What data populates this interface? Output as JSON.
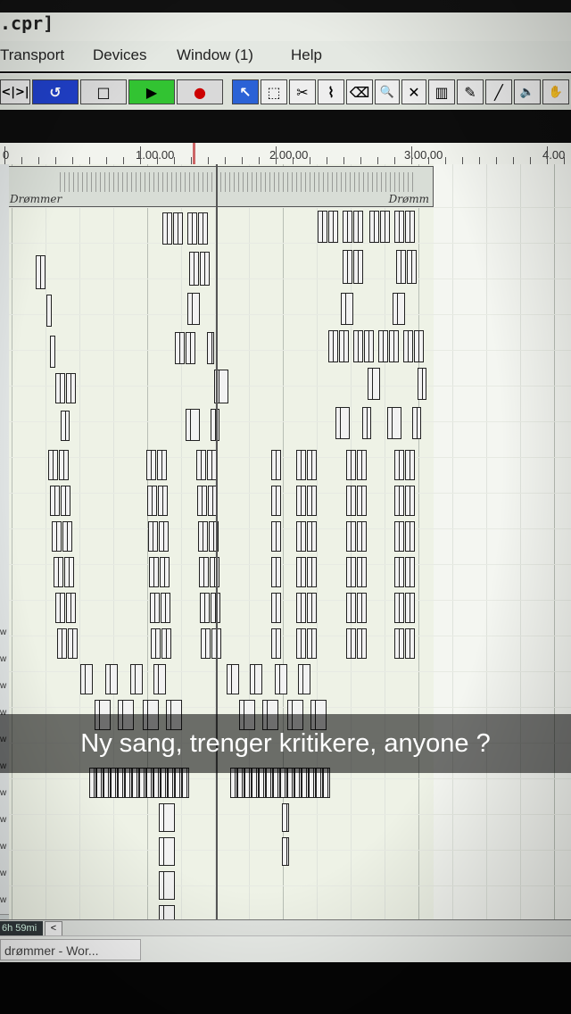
{
  "window": {
    "title": ".cpr]"
  },
  "menu": {
    "items": [
      "Transport",
      "Devices",
      "Window (1)",
      "Help"
    ]
  },
  "toolbar": {
    "transport_buttons": [
      {
        "icon": "skip-icon",
        "label": "<|>|"
      },
      {
        "icon": "cycle-icon",
        "label": "↺"
      },
      {
        "icon": "stop-icon",
        "label": "□"
      },
      {
        "icon": "play-icon",
        "label": "▶"
      },
      {
        "icon": "record-icon",
        "label": "●"
      }
    ],
    "tools": [
      {
        "icon": "pointer-icon",
        "glyph": "↖"
      },
      {
        "icon": "range-select-icon",
        "glyph": "⬚"
      },
      {
        "icon": "split-icon",
        "glyph": "✂"
      },
      {
        "icon": "glue-icon",
        "glyph": "⌇"
      },
      {
        "icon": "erase-icon",
        "glyph": "⌫"
      },
      {
        "icon": "zoom-icon",
        "glyph": "🔍"
      },
      {
        "icon": "mute-icon",
        "glyph": "✕"
      },
      {
        "icon": "comp-icon",
        "glyph": "▥"
      },
      {
        "icon": "draw-icon",
        "glyph": "✎"
      },
      {
        "icon": "line-icon",
        "glyph": "╱"
      },
      {
        "icon": "speaker-icon",
        "glyph": "🔈"
      },
      {
        "icon": "hand-icon",
        "glyph": "✋"
      }
    ],
    "colors": {
      "cycle": "#1f3fc7",
      "play": "#32c332",
      "record": "#cc0000",
      "pointer": "#2a62d6"
    }
  },
  "ruler": {
    "labels": [
      "0",
      "1.00.00",
      "2.00.00",
      "3.00.00",
      "4.00"
    ]
  },
  "arrange": {
    "drum_part_label": "Drømmer",
    "drum_part_label_right": "Drømm"
  },
  "track_list": {
    "button_glyph": "w"
  },
  "status": {
    "time_display": "6h 59mi",
    "scroll_left_glyph": "<"
  },
  "taskbar": {
    "item": "drømmer - Wor..."
  },
  "caption": {
    "text": "Ny sang, trenger kritikere, anyone ?"
  }
}
